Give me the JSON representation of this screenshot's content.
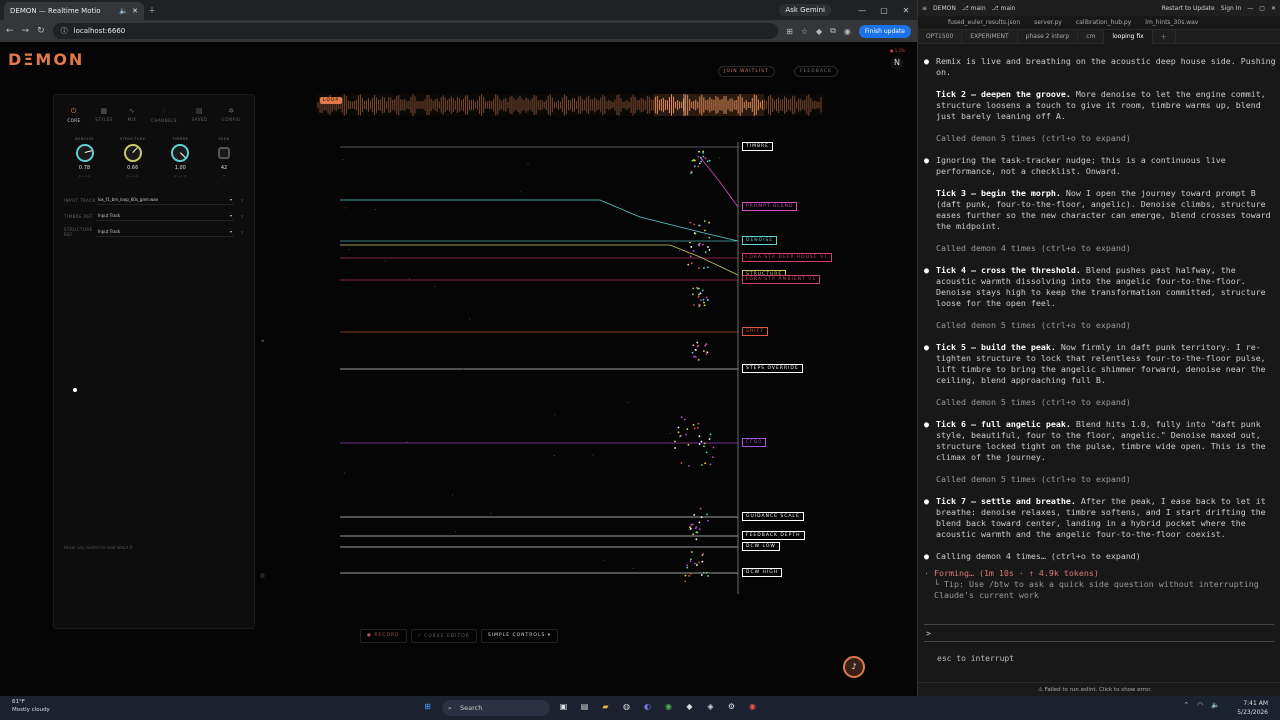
{
  "browser": {
    "tab_title": "DEMON — Realtime Motio",
    "ask": "Ask Gemini",
    "url": "localhost:6660",
    "finish_update": "Finish update"
  },
  "demon": {
    "logo": "DΞMON",
    "join_waitlist": "JOIN WAITLIST",
    "feedback": "FEEDBACK",
    "cpu": "● 1.2%",
    "loop_badge": "LOOP",
    "tabs": [
      {
        "label": "CORE",
        "icon": "⏻"
      },
      {
        "label": "STYLES",
        "icon": "▦"
      },
      {
        "label": "MIX",
        "icon": "∿"
      },
      {
        "label": "CHANNELS",
        "icon": "⫶"
      },
      {
        "label": "SAVED",
        "icon": "▤"
      },
      {
        "label": "CONFIG",
        "icon": "✲"
      }
    ],
    "knobs": [
      {
        "label": "DENOISE",
        "value": "0.78",
        "sub": "0 → 1 ↺",
        "color": "#5fd1d1",
        "level": 0.78
      },
      {
        "label": "STRUCTURE",
        "value": "0.66",
        "sub": "0 → 1 ↺",
        "color": "#c9c96a",
        "level": 0.66
      },
      {
        "label": "TIMBRE",
        "value": "1.00",
        "sub": "0 → 1 ↺",
        "color": "#5fd1d1",
        "level": 1.0
      },
      {
        "label": "SEED",
        "value": "42",
        "sub": "↺",
        "color": "#888",
        "level": 0
      }
    ],
    "fields": [
      {
        "label": "INPUT TRACK",
        "value": "lox_f1_bm_loop_60s_gnm.wav"
      },
      {
        "label": "TIMBRE REF",
        "value": "Input Track"
      },
      {
        "label": "STRUCTURE REF",
        "value": "Input Track"
      }
    ],
    "hint": "Hover any control to read about it",
    "lanes": [
      {
        "label": "TIMBRE",
        "color": "#ffffff"
      },
      {
        "label": "PROMPT BLEND",
        "color": "#d050c0"
      },
      {
        "label": "DENOISE",
        "color": "#5fd1d1"
      },
      {
        "label": "LORA STR DEEP HOUSE V1",
        "color": "#d04070"
      },
      {
        "label": "STRUCTURE",
        "color": "#c9c96a"
      },
      {
        "label": "LORA STR AMBIENT V1",
        "color": "#d04070"
      },
      {
        "label": "SHIFT",
        "color": "#e05a3a"
      },
      {
        "label": "STEPS OVERRIDE",
        "color": "#ffffff"
      },
      {
        "label": "CFG0",
        "color": "#b050e0"
      },
      {
        "label": "GUIDANCE SCALE",
        "color": "#ffffff"
      },
      {
        "label": "FEEDBACK DEPTH",
        "color": "#ffffff"
      },
      {
        "label": "DCW LOW",
        "color": "#ffffff"
      },
      {
        "label": "DCW HIGH",
        "color": "#ffffff"
      }
    ],
    "bottom": {
      "record": "● RECORD",
      "curve": "⟋ CURVE EDITOR",
      "simple": "SIMPLE CONTROLS ▾"
    },
    "fab_icon": "♪"
  },
  "terminal": {
    "title": "DEMON",
    "branches": [
      "⎇ main",
      "⎇ main"
    ],
    "restart": "Restart to Update",
    "signin": "Sign In",
    "files": [
      "fused_euler_results.json",
      "server.py",
      "calibration_hub.py",
      "lm_hints_30s.wav"
    ],
    "tabs": [
      "OPT1500",
      "EXPERIMENT",
      "phase 2 interp",
      "cm",
      "looping fix"
    ],
    "blocks": [
      {
        "type": "bullet",
        "bold": "",
        "text": "Remix is live and breathing on the acoustic deep house side. Pushing on."
      },
      {
        "type": "para",
        "bold": "Tick 2 — deepen the groove.",
        "text": " More denoise to let the engine commit, structure loosens a touch to give it room, timbre warms up, blend just barely leaning off A."
      },
      {
        "type": "called",
        "text": "Called demon 5 times (ctrl+o to expand)"
      },
      {
        "type": "bullet",
        "bold": "",
        "text": "Ignoring the task-tracker nudge; this is a continuous live performance, not a checklist. Onward."
      },
      {
        "type": "para",
        "bold": "Tick 3 — begin the morph.",
        "text": " Now I open the journey toward prompt B (daft punk, four-to-the-floor, angelic). Denoise climbs, structure eases further so the new character can emerge, blend crosses toward the midpoint."
      },
      {
        "type": "called",
        "text": "Called demon 4 times (ctrl+o to expand)"
      },
      {
        "type": "bullet",
        "bold": "Tick 4 — cross the threshold.",
        "text": " Blend pushes past halfway, the acoustic warmth dissolving into the angelic four-to-the-floor. Denoise stays high to keep the transformation committed, structure loose for the open feel."
      },
      {
        "type": "called",
        "text": "Called demon 5 times (ctrl+o to expand)"
      },
      {
        "type": "bullet",
        "bold": "Tick 5 — build the peak.",
        "text": " Now firmly in daft punk territory. I re-tighten structure to lock that relentless four-to-the-floor pulse, lift timbre to bring the angelic shimmer forward, denoise near the ceiling, blend approaching full B."
      },
      {
        "type": "called",
        "text": "Called demon 5 times (ctrl+o to expand)"
      },
      {
        "type": "bullet",
        "bold": "Tick 6 — full angelic peak.",
        "text": " Blend hits 1.0, fully into \"daft punk style, beautiful, four to the floor, angelic.\" Denoise maxed out, structure locked tight on the pulse, timbre wide open. This is the climax of the journey."
      },
      {
        "type": "called",
        "text": "Called demon 5 times (ctrl+o to expand)"
      },
      {
        "type": "bullet",
        "bold": "Tick 7 — settle and breathe.",
        "text": " After the peak, I ease back to let it breathe: denoise relaxes, timbre softens, and I start drifting the blend back toward center, landing in a hybrid pocket where the acoustic warmth and the angelic four-to-the-floor coexist."
      },
      {
        "type": "bullet",
        "bold": "",
        "text": "Calling demon 4 times… (ctrl+o to expand)"
      }
    ],
    "forming": "· Forming… (1m 10s · ↑ 4.9k tokens)",
    "tip": "└ Tip: Use /btw to ask a quick side question without interrupting Claude's current work",
    "prompt": ">",
    "esc": "esc to interrupt",
    "status": "⚠ Failed to run eslint. Click to show error."
  },
  "taskbar": {
    "temp": "61°F",
    "weather": "Mostly cloudy",
    "search": "Search",
    "time": "7:41 AM",
    "date": "5/23/2026"
  }
}
